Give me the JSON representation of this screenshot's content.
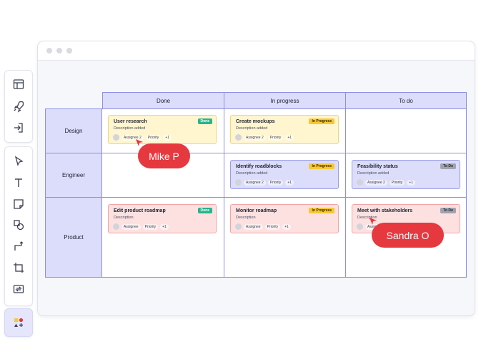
{
  "board": {
    "columns": [
      "Done",
      "In progress",
      "To do"
    ],
    "rows": [
      "Design",
      "Engineer",
      "Product"
    ]
  },
  "cards": {
    "user_research": {
      "title": "User research",
      "desc": "Description added",
      "assignee": "Assignee 2",
      "priority": "Priority",
      "more": "+1",
      "status": "Done"
    },
    "create_mockups": {
      "title": "Create mockups",
      "desc": "Description added",
      "assignee": "Assignee 2",
      "priority": "Priority",
      "more": "+1",
      "status": "In Progress"
    },
    "identify_roadblocks": {
      "title": "Identify roadblocks",
      "desc": "Description added",
      "assignee": "Assignee 2",
      "priority": "Priority",
      "more": "+1",
      "status": "In Progress"
    },
    "feasibility_status": {
      "title": "Feasibility status",
      "desc": "Description added",
      "assignee": "Assignee 2",
      "priority": "Priority",
      "more": "+1",
      "status": "To Do"
    },
    "edit_product_roadmap": {
      "title": "Edit product roadmap",
      "desc": "Description",
      "assignee": "Assignee",
      "priority": "Priority",
      "more": "+1",
      "status": "Done"
    },
    "monitor_roadmap": {
      "title": "Monitor roadmap",
      "desc": "Description",
      "assignee": "Assignee",
      "priority": "Priority",
      "more": "+1",
      "status": "In Progress"
    },
    "meet_stakeholders": {
      "title": "Meet with stakeholders",
      "desc": "Description",
      "assignee": "Assignee",
      "status": "To Do"
    }
  },
  "collaborators": {
    "mike": "Mike P",
    "sandra": "Sandra O"
  },
  "colors": {
    "accent": "#8c8fe4",
    "header_fill": "#dcdcfb",
    "cursor": "#e5383f",
    "done": "#29b38b",
    "in_progress": "#f7c836",
    "todo": "#a0a3ad"
  },
  "icons": {
    "toolbar_top": [
      "layout-icon",
      "rocket-icon",
      "import-icon"
    ],
    "toolbar_tools": [
      "select-arrow-icon",
      "text-icon",
      "sticky-note-icon",
      "shapes-icon",
      "connector-icon",
      "frame-icon",
      "image-swap-icon"
    ],
    "toolbar_bottom": [
      "shape-library-icon"
    ]
  }
}
